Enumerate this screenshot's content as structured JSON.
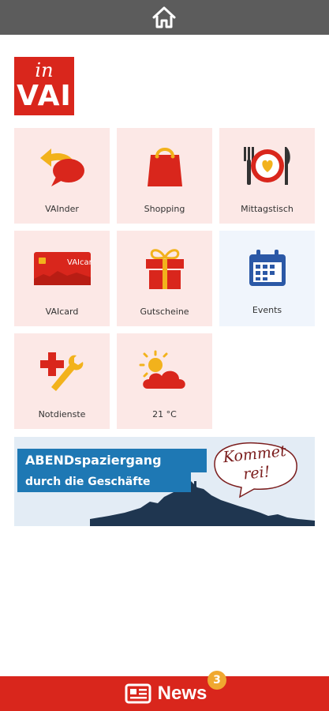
{
  "colors": {
    "topbar": "#5c5c5c",
    "accent": "#d9261c",
    "tile_bg": "#fce8e6",
    "tile_bg_blue": "#f0f5fc",
    "events_blue": "#2b58a6",
    "badge": "#f0a830"
  },
  "header": {
    "home_icon": "home-icon"
  },
  "logo": {
    "top": "in",
    "bottom": "VAI"
  },
  "tiles": [
    {
      "label": "VAInder",
      "icon": "speech-bubble-arrow-icon"
    },
    {
      "label": "Shopping",
      "icon": "shopping-bag-icon"
    },
    {
      "label": "Mittagstisch",
      "icon": "plate-cutlery-icon"
    },
    {
      "label": "VAIcard",
      "icon": "card-icon",
      "card_text": "VAIcard"
    },
    {
      "label": "Gutscheine",
      "icon": "gift-icon"
    },
    {
      "label": "Events",
      "icon": "calendar-icon"
    },
    {
      "label": "Notdienste",
      "icon": "cross-wrench-icon"
    },
    {
      "label": "21 °C",
      "icon": "weather-icon"
    }
  ],
  "banner": {
    "line1": "ABENDspaziergang",
    "line2": "durch die Geschäfte",
    "bubble_line1": "Kommet",
    "bubble_line2": "rei!"
  },
  "footer": {
    "news_label": "News",
    "badge_count": "3"
  }
}
